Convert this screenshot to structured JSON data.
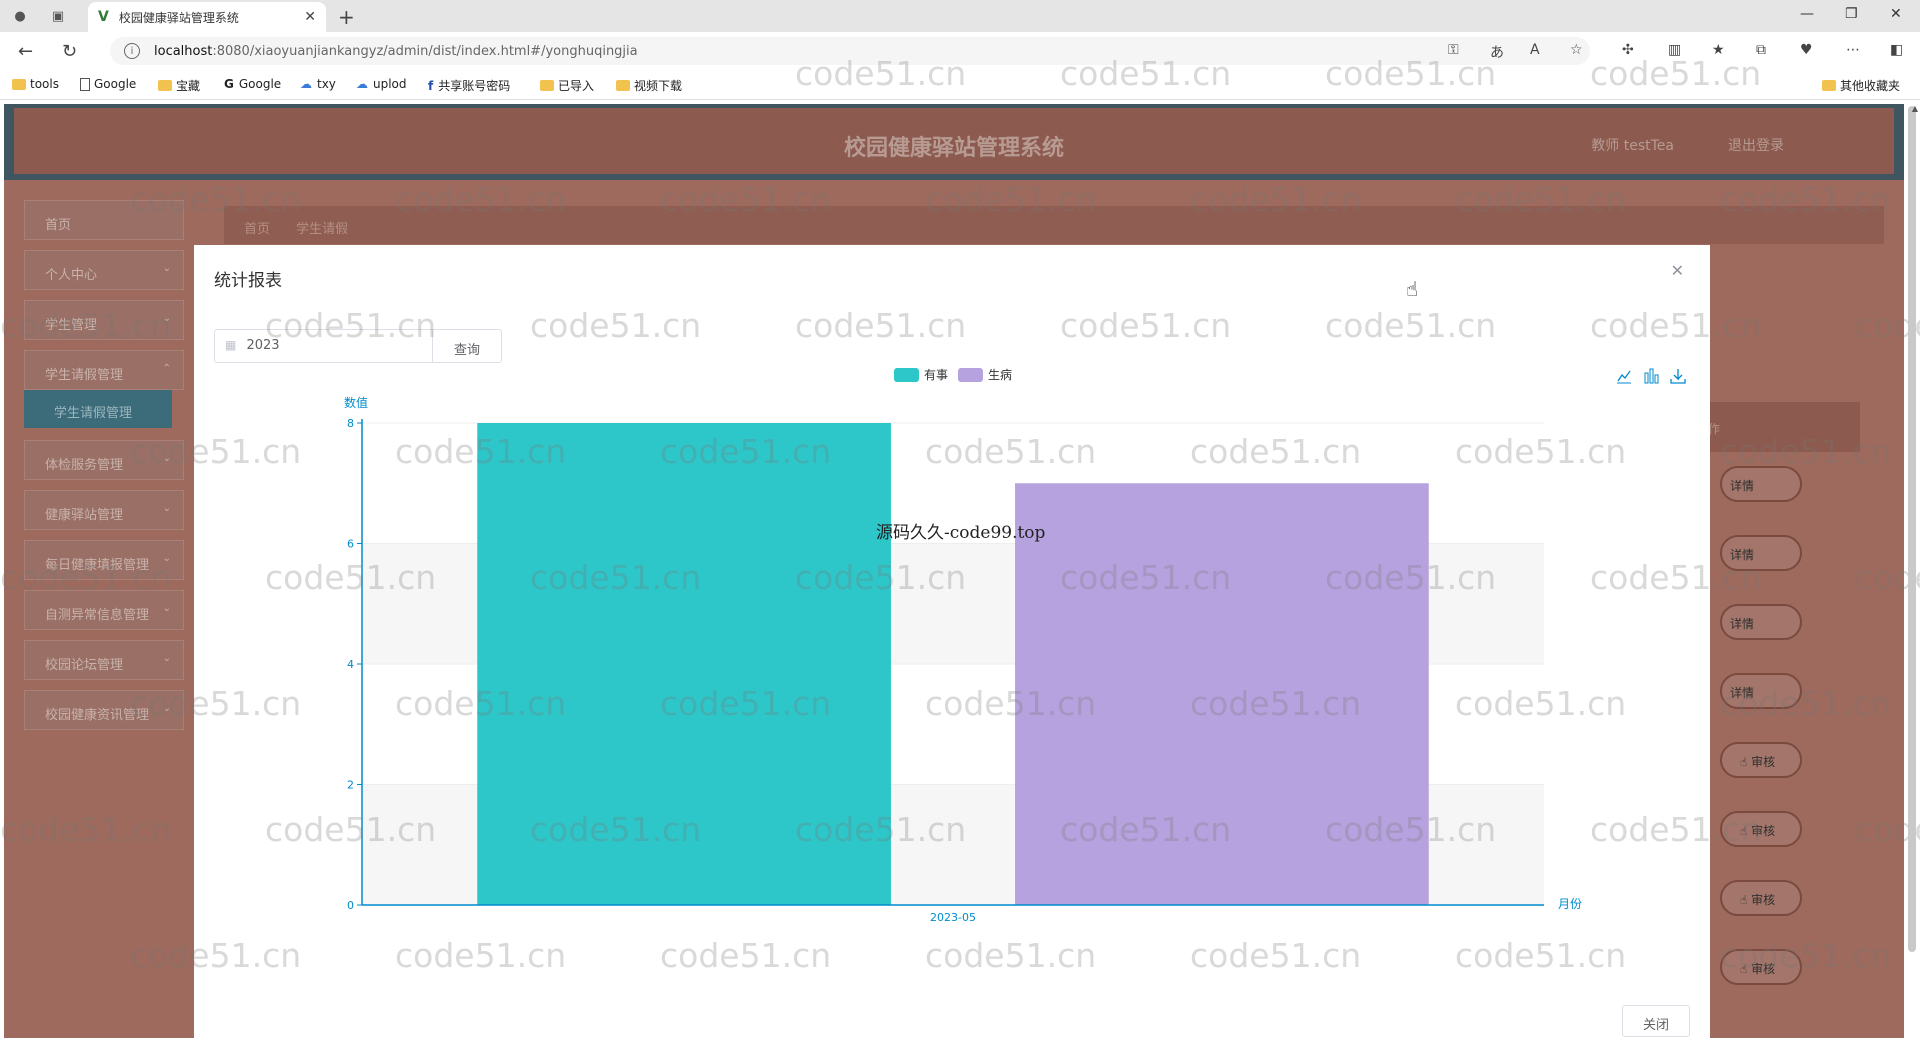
{
  "browser": {
    "tab_title": "校园健康驿站管理系统",
    "url_host": "localhost",
    "url_path": ":8080/xiaoyuanjiankangyz/admin/dist/index.html#/yonghuqingjia",
    "bookmarks": [
      "tools",
      "Google",
      "宝藏",
      "Google",
      "txy",
      "uplod",
      "共享账号密码",
      "已导入",
      "视频下载"
    ],
    "other_bookmarks": "其他收藏夹"
  },
  "app": {
    "title": "校园健康驿站管理系统",
    "user": "教师 testTea",
    "logout": "退出登录"
  },
  "sidebar": {
    "items": [
      {
        "label": "首页"
      },
      {
        "label": "个人中心"
      },
      {
        "label": "学生管理"
      },
      {
        "label": "学生请假管理"
      },
      {
        "label": "体检服务管理"
      },
      {
        "label": "健康驿站管理"
      },
      {
        "label": "每日健康填报管理"
      },
      {
        "label": "自测异常信息管理"
      },
      {
        "label": "校园论坛管理"
      },
      {
        "label": "校园健康资讯管理"
      }
    ],
    "sub_active": "学生请假管理"
  },
  "breadcrumb": [
    "首页",
    "学生请假"
  ],
  "right_panel": {
    "header": "作",
    "detail_label": "详情",
    "audit_label": "审核"
  },
  "modal": {
    "title": "统计报表",
    "year_value": "2023",
    "query_label": "查询",
    "close_label": "关闭"
  },
  "chart_data": {
    "type": "bar",
    "categories": [
      "2023-05"
    ],
    "series": [
      {
        "name": "有事",
        "values": [
          8
        ],
        "color": "#2ec7c9"
      },
      {
        "name": "生病",
        "values": [
          7
        ],
        "color": "#b6a2de"
      }
    ],
    "ylabel": "数值",
    "xlabel": "月份",
    "ylim": [
      0,
      8
    ],
    "yticks": [
      0,
      2,
      4,
      6,
      8
    ],
    "legend_position": "top-center",
    "grid": true,
    "toolbox": [
      "line-chart-icon",
      "bar-chart-icon",
      "download-icon"
    ]
  },
  "watermark": {
    "text": "code51.cn",
    "center_text": "源码久久-code99.top"
  }
}
